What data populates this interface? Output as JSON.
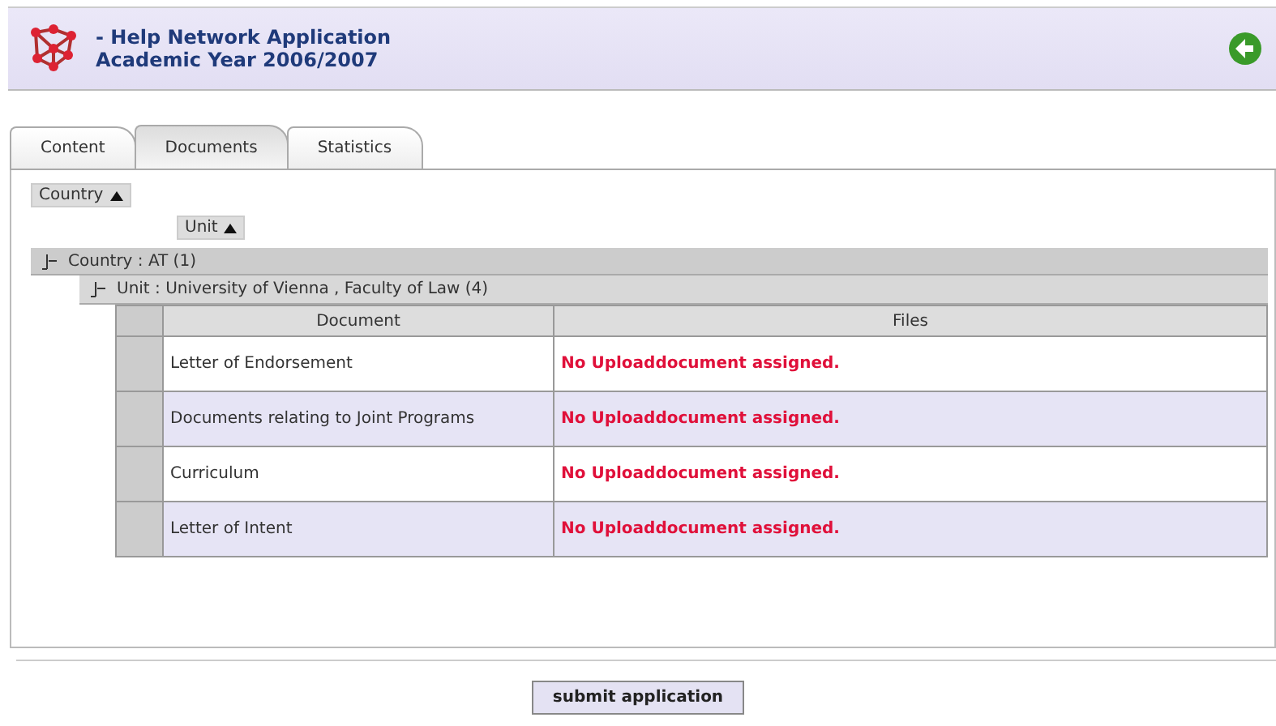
{
  "header": {
    "title": "- Help Network Application",
    "subtitle": "Academic Year 2006/2007"
  },
  "tabs": [
    {
      "label": "Content",
      "selected": false
    },
    {
      "label": "Documents",
      "selected": true
    },
    {
      "label": "Statistics",
      "selected": false
    }
  ],
  "group_by": [
    {
      "label": "Country"
    },
    {
      "label": "Unit"
    }
  ],
  "groups": [
    {
      "label": "Country : AT (1)",
      "expanded": true,
      "children": [
        {
          "label": "Unit : University of Vienna , Faculty of Law (4)",
          "expanded": true
        }
      ]
    }
  ],
  "table": {
    "columns": [
      "Document",
      "Files"
    ],
    "rows": [
      {
        "document": "Letter of Endorsement",
        "files": "No Uploaddocument assigned."
      },
      {
        "document": "Documents relating to Joint Programs",
        "files": "No Uploaddocument assigned."
      },
      {
        "document": "Curriculum",
        "files": "No Uploaddocument assigned."
      },
      {
        "document": "Letter of Intent",
        "files": "No Uploaddocument assigned."
      }
    ]
  },
  "submit_button": "submit application"
}
